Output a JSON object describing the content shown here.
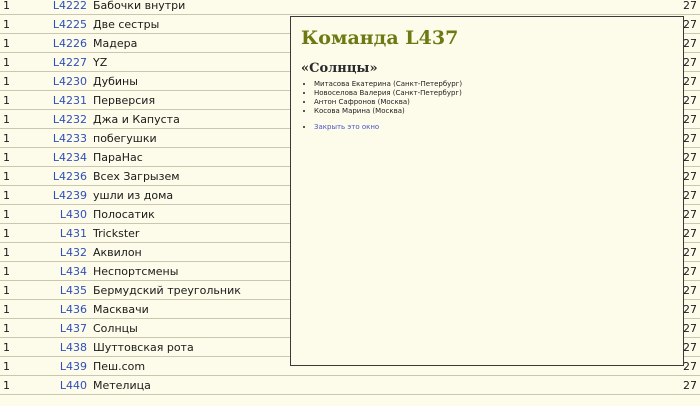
{
  "rows": [
    {
      "place": "1",
      "id": "L4222",
      "name": "Бабочки внутри",
      "score": "27"
    },
    {
      "place": "1",
      "id": "L4225",
      "name": "Две сестры",
      "score": "27"
    },
    {
      "place": "1",
      "id": "L4226",
      "name": "Мадера",
      "score": "27"
    },
    {
      "place": "1",
      "id": "L4227",
      "name": "YZ",
      "score": "27"
    },
    {
      "place": "1",
      "id": "L4230",
      "name": "Дубины",
      "score": "27"
    },
    {
      "place": "1",
      "id": "L4231",
      "name": "Перверсия",
      "score": "27"
    },
    {
      "place": "1",
      "id": "L4232",
      "name": "Джа и Капуста",
      "score": "27"
    },
    {
      "place": "1",
      "id": "L4233",
      "name": "побегушки",
      "score": "27"
    },
    {
      "place": "1",
      "id": "L4234",
      "name": "ПараНас",
      "score": "27"
    },
    {
      "place": "1",
      "id": "L4236",
      "name": "Всех Загрызем",
      "score": "27"
    },
    {
      "place": "1",
      "id": "L4239",
      "name": "ушли из дома",
      "score": "27"
    },
    {
      "place": "1",
      "id": "L430",
      "name": "Полосатик",
      "score": "27"
    },
    {
      "place": "1",
      "id": "L431",
      "name": "Trickster",
      "score": "27"
    },
    {
      "place": "1",
      "id": "L432",
      "name": "Аквилон",
      "score": "27"
    },
    {
      "place": "1",
      "id": "L434",
      "name": "Неспортсмены",
      "score": "27"
    },
    {
      "place": "1",
      "id": "L435",
      "name": "Бермудский треугольник",
      "score": "27"
    },
    {
      "place": "1",
      "id": "L436",
      "name": "Масквачи",
      "score": "27"
    },
    {
      "place": "1",
      "id": "L437",
      "name": "Солнцы",
      "score": "27"
    },
    {
      "place": "1",
      "id": "L438",
      "name": "Шуттовская рота",
      "score": "27"
    },
    {
      "place": "1",
      "id": "L439",
      "name": "Пеш.com",
      "score": "27"
    },
    {
      "place": "1",
      "id": "L440",
      "name": "Метелица",
      "score": "27"
    }
  ],
  "popup": {
    "title": "Команда L437",
    "team_name": "«Солнцы»",
    "members": [
      "Митасова Екатерина (Санкт-Петербург)",
      "Новоселова Валерия (Санкт-Петербург)",
      "Антон Сафронов (Москва)",
      "Косова Марина (Москва)"
    ],
    "close_label": "Закрыть это окно"
  }
}
